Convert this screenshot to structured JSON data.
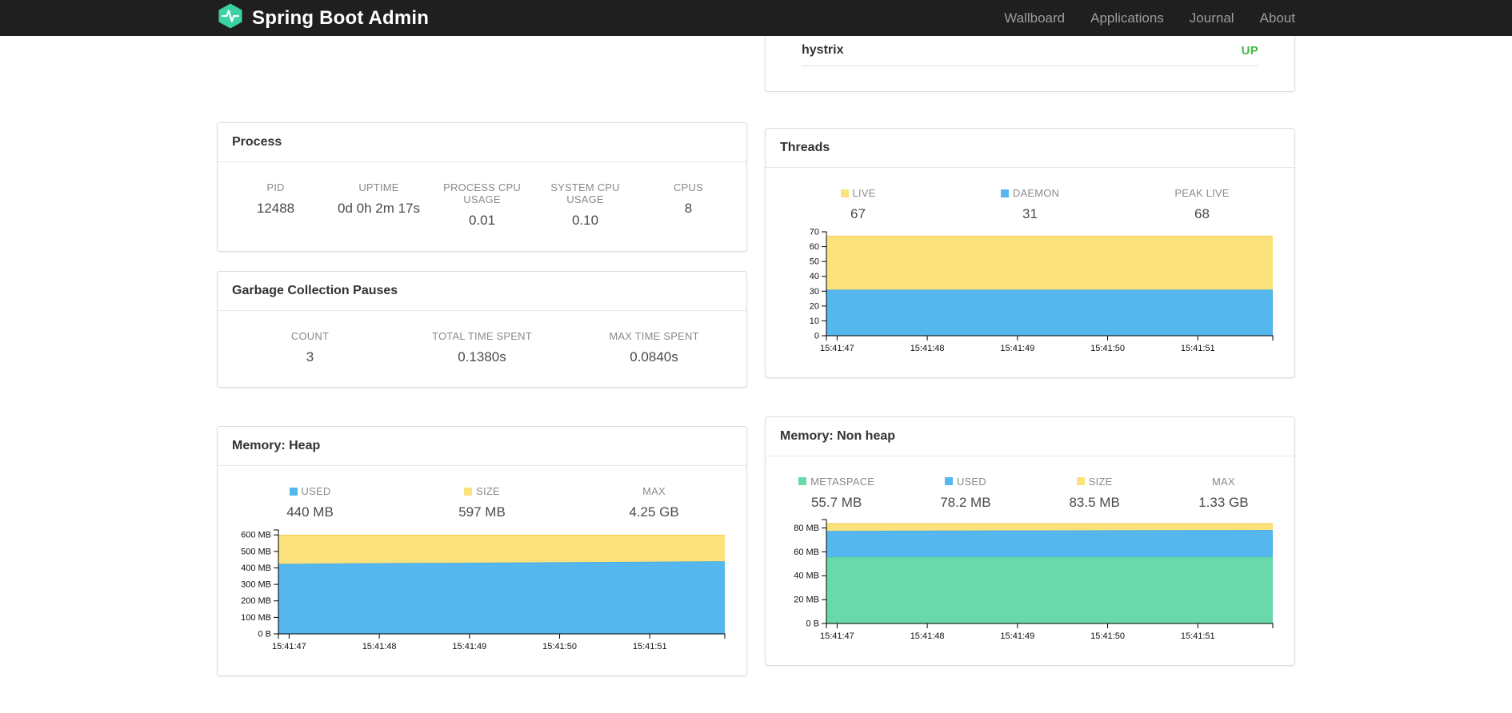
{
  "navbar": {
    "brand": "Spring Boot Admin",
    "brand_color": "#3bd1a2",
    "links": [
      {
        "label": "Wallboard"
      },
      {
        "label": "Applications"
      },
      {
        "label": "Journal"
      },
      {
        "label": "About"
      }
    ]
  },
  "status_panel": {
    "service": "hystrix",
    "status": "UP",
    "status_color": "#43b843"
  },
  "process": {
    "title": "Process",
    "metrics": [
      {
        "label": "PID",
        "value": "12488"
      },
      {
        "label": "UPTIME",
        "value": "0d 0h 2m 17s"
      },
      {
        "label": "PROCESS CPU USAGE",
        "value": "0.01"
      },
      {
        "label": "SYSTEM CPU USAGE",
        "value": "0.10"
      },
      {
        "label": "CPUS",
        "value": "8"
      }
    ]
  },
  "gc": {
    "title": "Garbage Collection Pauses",
    "metrics": [
      {
        "label": "COUNT",
        "value": "3"
      },
      {
        "label": "TOTAL TIME SPENT",
        "value": "0.1380s"
      },
      {
        "label": "MAX TIME SPENT",
        "value": "0.0840s"
      }
    ]
  },
  "threads": {
    "title": "Threads",
    "metrics": [
      {
        "label": "LIVE",
        "value": "67",
        "swatch": "#fce27d"
      },
      {
        "label": "DAEMON",
        "value": "31",
        "swatch": "#55b7ee"
      },
      {
        "label": "PEAK LIVE",
        "value": "68"
      }
    ]
  },
  "heap": {
    "title": "Memory: Heap",
    "metrics": [
      {
        "label": "USED",
        "value": "440 MB",
        "swatch": "#55b7ee"
      },
      {
        "label": "SIZE",
        "value": "597 MB",
        "swatch": "#fce27d"
      },
      {
        "label": "MAX",
        "value": "4.25 GB"
      }
    ]
  },
  "nonheap": {
    "title": "Memory: Non heap",
    "metrics": [
      {
        "label": "METASPACE",
        "value": "55.7 MB",
        "swatch": "#69d9ab"
      },
      {
        "label": "USED",
        "value": "78.2 MB",
        "swatch": "#55b7ee"
      },
      {
        "label": "SIZE",
        "value": "83.5 MB",
        "swatch": "#fce27d"
      },
      {
        "label": "MAX",
        "value": "1.33 GB"
      }
    ]
  },
  "chart_data": [
    {
      "id": "threads",
      "type": "area",
      "stacked": true,
      "title": "Threads",
      "x": [
        "15:41:47",
        "15:41:48",
        "15:41:49",
        "15:41:50",
        "15:41:51"
      ],
      "ymax": 70,
      "yticks": [
        {
          "v": 0,
          "t": "0"
        },
        {
          "v": 10,
          "t": "10"
        },
        {
          "v": 20,
          "t": "20"
        },
        {
          "v": 30,
          "t": "30"
        },
        {
          "v": 40,
          "t": "40"
        },
        {
          "v": 50,
          "t": "50"
        },
        {
          "v": 60,
          "t": "60"
        },
        {
          "v": 70,
          "t": "70"
        }
      ],
      "series": [
        {
          "name": "DAEMON",
          "fill": "#55b7ee",
          "stroke": "#3fa8e3",
          "values": [
            31,
            31,
            31,
            31,
            31,
            31
          ]
        },
        {
          "name": "LIVE",
          "fill": "#fce27d",
          "stroke": "#f4d35e",
          "values": [
            67,
            67,
            67,
            67,
            67,
            67
          ]
        }
      ]
    },
    {
      "id": "heap",
      "type": "area",
      "stacked": true,
      "title": "Memory: Heap",
      "x": [
        "15:41:47",
        "15:41:48",
        "15:41:49",
        "15:41:50",
        "15:41:51"
      ],
      "ymax": 630,
      "yticks": [
        {
          "v": 0,
          "t": "0 B"
        },
        {
          "v": 100,
          "t": "100 MB"
        },
        {
          "v": 200,
          "t": "200 MB"
        },
        {
          "v": 300,
          "t": "300 MB"
        },
        {
          "v": 400,
          "t": "400 MB"
        },
        {
          "v": 500,
          "t": "500 MB"
        },
        {
          "v": 600,
          "t": "600 MB"
        }
      ],
      "series": [
        {
          "name": "USED",
          "fill": "#55b7ee",
          "stroke": "#3fa8e3",
          "values": [
            424,
            428,
            431,
            434,
            437,
            440
          ]
        },
        {
          "name": "SIZE",
          "fill": "#fce27d",
          "stroke": "#f4d35e",
          "values": [
            597,
            597,
            597,
            597,
            597,
            597
          ]
        }
      ]
    },
    {
      "id": "nonheap",
      "type": "area",
      "stacked": true,
      "title": "Memory: Non heap",
      "x": [
        "15:41:47",
        "15:41:48",
        "15:41:49",
        "15:41:50",
        "15:41:51"
      ],
      "ymax": 87,
      "yticks": [
        {
          "v": 0,
          "t": "0 B"
        },
        {
          "v": 20,
          "t": "20 MB"
        },
        {
          "v": 40,
          "t": "40 MB"
        },
        {
          "v": 60,
          "t": "60 MB"
        },
        {
          "v": 80,
          "t": "80 MB"
        }
      ],
      "series": [
        {
          "name": "METASPACE",
          "fill": "#69d9ab",
          "stroke": "#4ecb97",
          "values": [
            55.7,
            55.7,
            55.7,
            55.7,
            55.7,
            55.7
          ]
        },
        {
          "name": "USED",
          "fill": "#55b7ee",
          "stroke": "#3fa8e3",
          "values": [
            77.5,
            77.7,
            77.9,
            78.0,
            78.1,
            78.2
          ]
        },
        {
          "name": "SIZE",
          "fill": "#fce27d",
          "stroke": "#f4d35e",
          "values": [
            83.5,
            83.5,
            83.5,
            83.5,
            83.5,
            83.5
          ]
        }
      ]
    }
  ]
}
